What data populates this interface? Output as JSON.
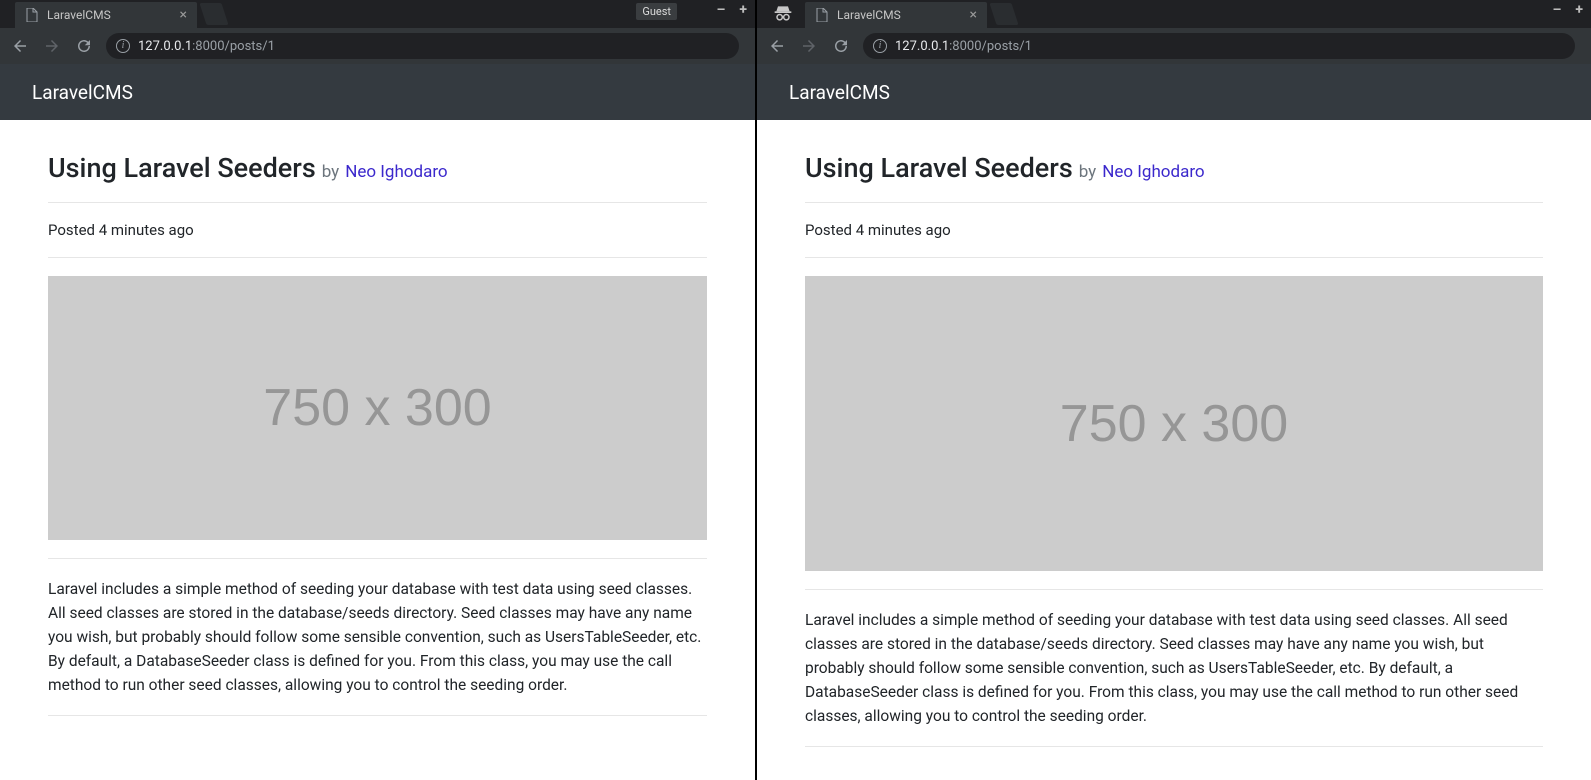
{
  "windows": [
    {
      "mode": "guest",
      "guest_label": "Guest",
      "tab_title": "LaravelCMS",
      "url_host": "127.0.0.1",
      "url_path": ":8000/posts/1",
      "app_brand": "LaravelCMS",
      "post": {
        "title": "Using Laravel Seeders",
        "by_label": "by",
        "author": "Neo Ighodaro",
        "posted": "Posted 4 minutes ago",
        "placeholder_text": "750 x 300",
        "body": "Laravel includes a simple method of seeding your database with test data using seed classes. All seed classes are stored in the database/seeds directory. Seed classes may have any name you wish, but probably should follow some sensible convention, such as UsersTableSeeder, etc. By default, a DatabaseSeeder class is defined for you. From this class, you may use the call method to run other seed classes, allowing you to control the seeding order."
      }
    },
    {
      "mode": "incognito",
      "tab_title": "LaravelCMS",
      "url_host": "127.0.0.1",
      "url_path": ":8000/posts/1",
      "app_brand": "LaravelCMS",
      "post": {
        "title": "Using Laravel Seeders",
        "by_label": "by",
        "author": "Neo Ighodaro",
        "posted": "Posted 4 minutes ago",
        "placeholder_text": "750 x 300",
        "body": "Laravel includes a simple method of seeding your database with test data using seed classes. All seed classes are stored in the database/seeds directory. Seed classes may have any name you wish, but probably should follow some sensible convention, such as UsersTableSeeder, etc. By default, a DatabaseSeeder class is defined for you. From this class, you may use the call method to run other seed classes, allowing you to control the seeding order."
      }
    }
  ]
}
